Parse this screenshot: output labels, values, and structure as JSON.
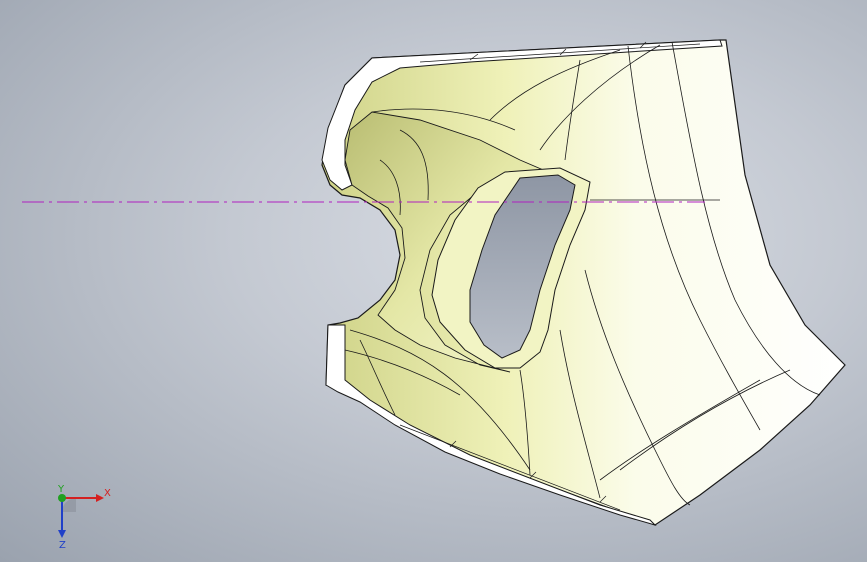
{
  "triad": {
    "x_label": "X",
    "y_label": "Y",
    "z_label": "Z",
    "x_color": "#d42020",
    "y_color": "#20a020",
    "z_color": "#2040c8"
  },
  "colors": {
    "surface": "#f4f6c8",
    "surface_shade": "#d8dc98",
    "edge": "#1a1a1a",
    "centerline": "#b020c0"
  }
}
